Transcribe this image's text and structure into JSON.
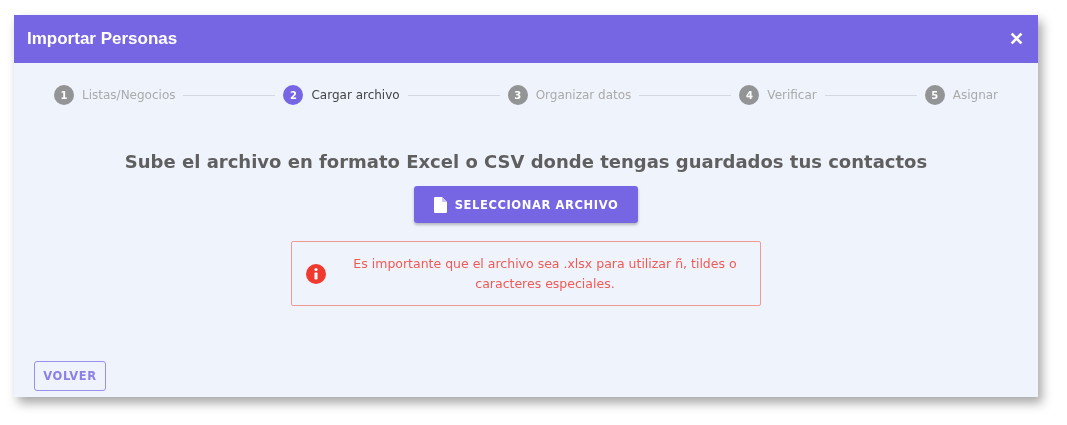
{
  "dialog": {
    "title": "Importar Personas",
    "close": "✕"
  },
  "steps": [
    {
      "number": "1",
      "label": "Listas/Negocios",
      "selected": false
    },
    {
      "number": "2",
      "label": "Cargar archivo",
      "selected": true
    },
    {
      "number": "3",
      "label": "Organizar datos",
      "selected": false
    },
    {
      "number": "4",
      "label": "Verificar",
      "selected": false
    },
    {
      "number": "5",
      "label": "Asignar",
      "selected": false
    }
  ],
  "heading": "Sube el archivo en formato Excel o CSV donde tengas guardados tus contactos",
  "upload_button": "SELECCIONAR ARCHIVO",
  "alert": {
    "kind": "error",
    "message": "Es importante que el archivo sea .xlsx para utilizar ñ, tildes o caracteres especiales."
  },
  "back_button": "VOLVER"
}
